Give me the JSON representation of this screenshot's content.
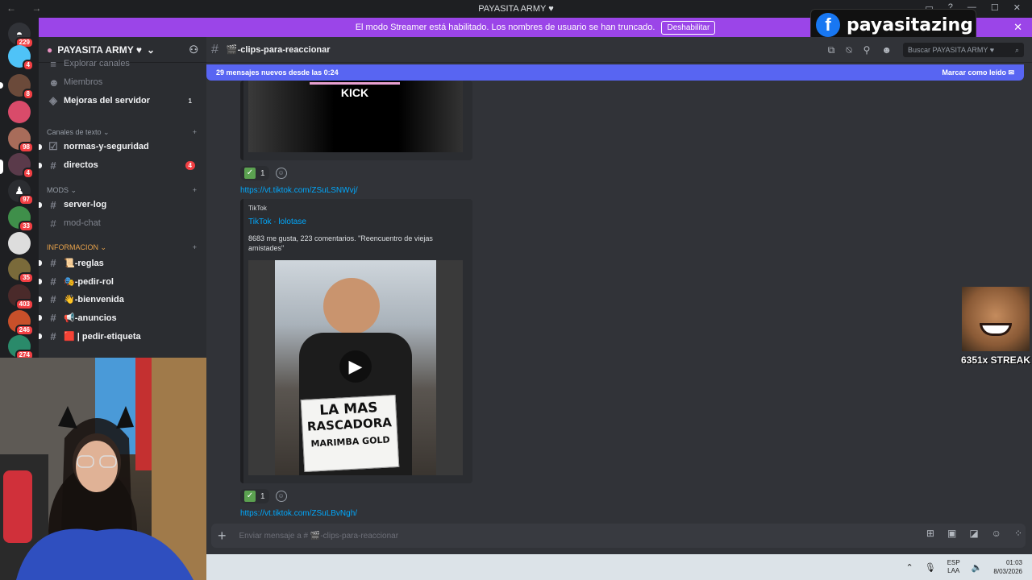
{
  "window": {
    "title": "PAYASITA ARMY ♥",
    "nav": "← →"
  },
  "banner": {
    "text": "El modo Streamer está habilitado. Los nombres de usuario se han truncado.",
    "button": "Deshabilitar"
  },
  "overlay": {
    "facebook_name": "payasitazing",
    "streak": "6351x STREAK"
  },
  "rail": {
    "badges": [
      "229",
      "4",
      "8",
      "98",
      "4",
      "97",
      "33",
      "35",
      "403",
      "246",
      "274"
    ]
  },
  "sidebar": {
    "server_name": "PAYASITA ARMY ♥",
    "top_items": [
      {
        "label": "Explorar canales"
      },
      {
        "label": "Miembros"
      },
      {
        "label": "Mejoras del servidor",
        "count": "1"
      }
    ],
    "categories": {
      "text": "Canales de texto",
      "mods": "MODS",
      "info": "INFORMACION"
    },
    "channels": [
      {
        "label": "normas-y-seguridad"
      },
      {
        "label": "directos",
        "count": "4"
      },
      {
        "label": "server-log"
      },
      {
        "label": "mod-chat"
      },
      {
        "label": "📜-reglas"
      },
      {
        "label": "🎭-pedir-rol"
      },
      {
        "label": "👋-bienvenida"
      },
      {
        "label": "📢-anuncios"
      },
      {
        "label": "🟥 | pedir-etiqueta"
      }
    ]
  },
  "header": {
    "channel": "🎬-clips-para-reaccionar",
    "search_placeholder": "Buscar PAYASITA ARMY ♥"
  },
  "newbar": {
    "text": "29 mensajes nuevos desde las 0:24",
    "action": "Marcar como leído"
  },
  "messages": {
    "embed1_text": "KICK",
    "reaction_count": "1",
    "link1": "https://vt.tiktok.com/ZSuLSNWvj/",
    "embed2": {
      "provider": "TikTok",
      "title": "TikTok · lolotase",
      "description": "8683 me gusta, 223 comentarios. \"Reencuentro de viejas amistades\"",
      "sign_line1": "LA MAS",
      "sign_line2": "RASCADORA",
      "sign_line3": "MARIMBA GOLD"
    },
    "reaction_count2": "1",
    "link2": "https://vt.tiktok.com/ZSuLBvNgh/"
  },
  "composer": {
    "placeholder": "Enviar mensaje a # 🎬-clips-para-reaccionar"
  },
  "taskbar": {
    "lang1": "ESP",
    "lang2": "LAA",
    "time": "01:03",
    "date": "8/03/2026"
  }
}
